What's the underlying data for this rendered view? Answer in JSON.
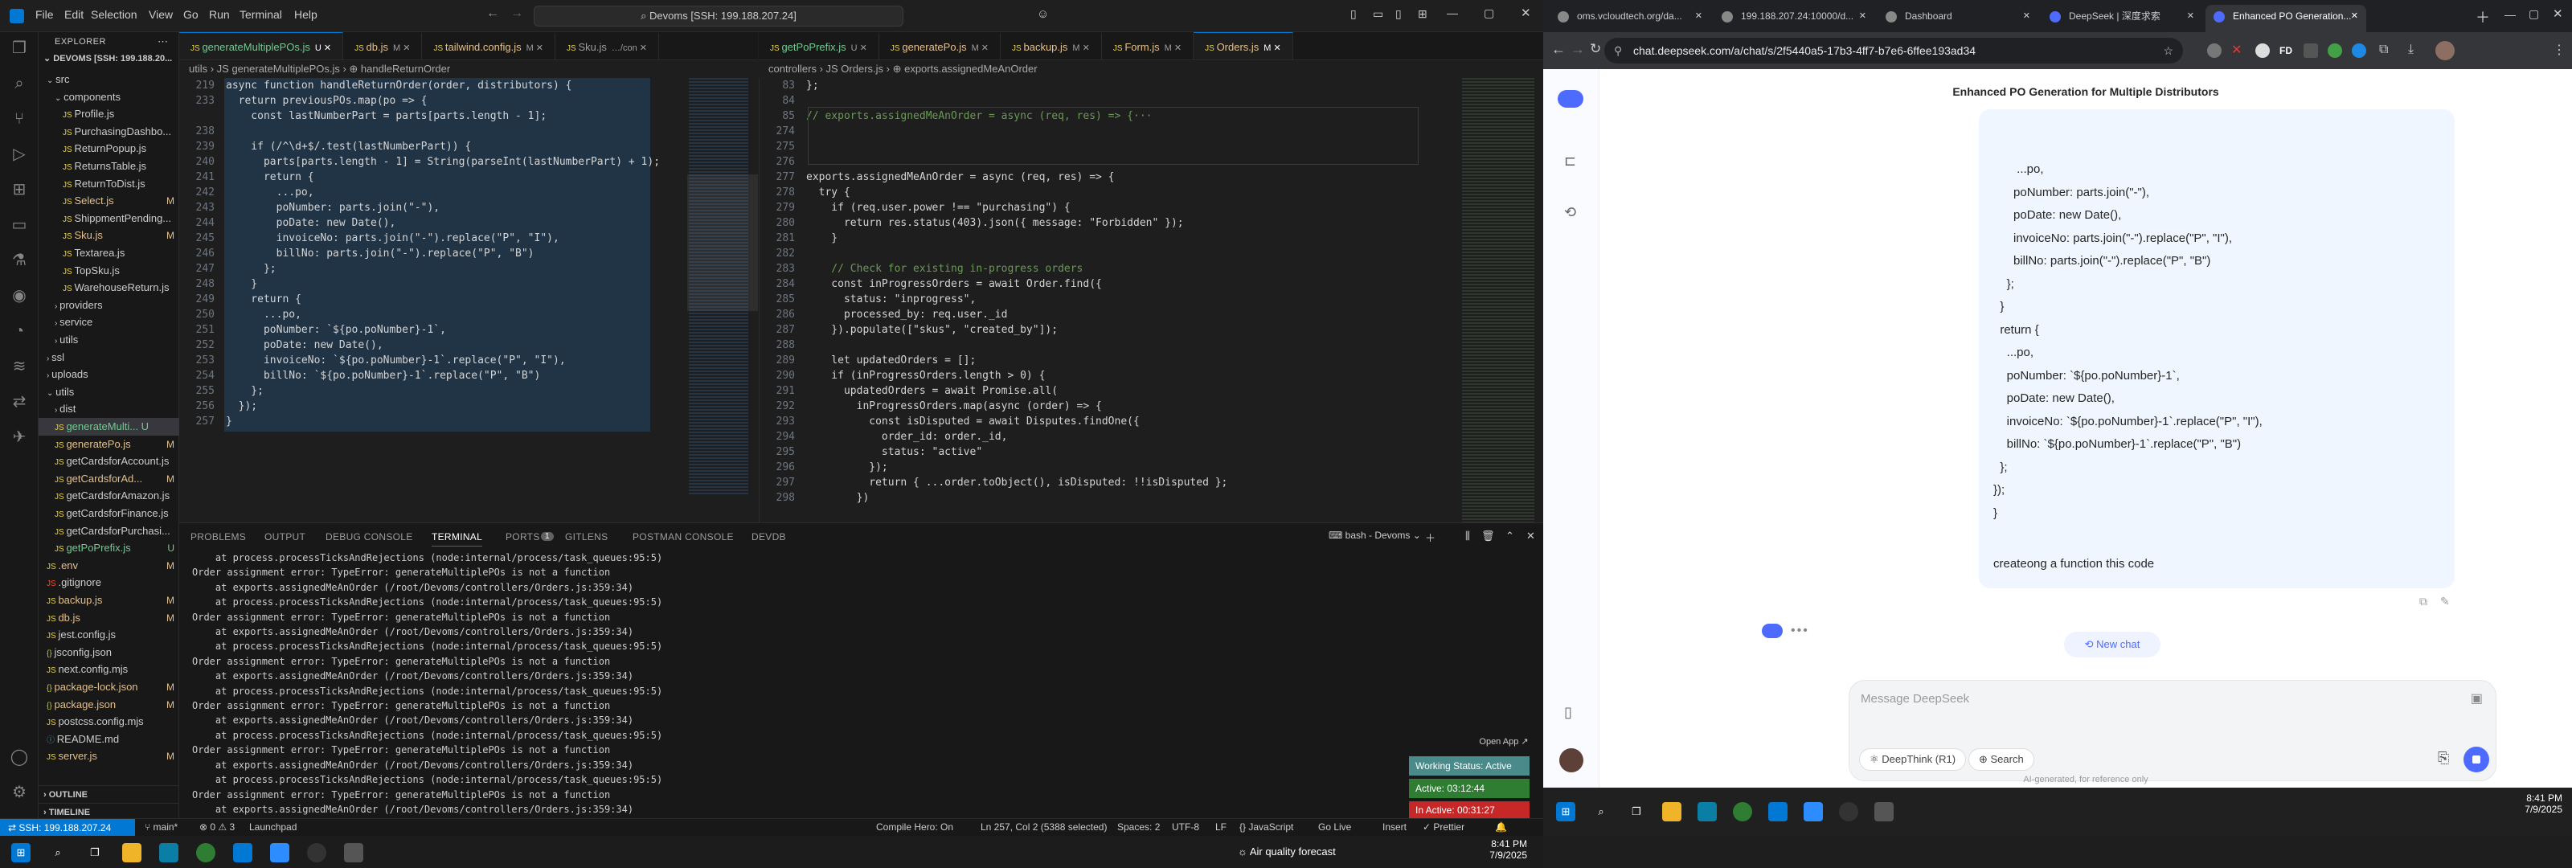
{
  "vscode": {
    "menu": [
      "File",
      "Edit",
      "Selection",
      "View",
      "Go",
      "Run",
      "Terminal",
      "Help"
    ],
    "search_text": "Devoms [SSH: 199.188.207.24]",
    "explorer_title": "EXPLORER",
    "workspace": "DEVOMS [SSH: 199.188.20...",
    "tree": [
      {
        "label": "src",
        "indent": 1,
        "type": "folder-open",
        "badge": ""
      },
      {
        "label": "components",
        "indent": 2,
        "type": "folder-open",
        "badge": ""
      },
      {
        "label": "Profile.js",
        "indent": 3,
        "type": "js",
        "badge": ""
      },
      {
        "label": "PurchasingDashbo...",
        "indent": 3,
        "type": "js",
        "badge": ""
      },
      {
        "label": "ReturnPopup.js",
        "indent": 3,
        "type": "js",
        "badge": ""
      },
      {
        "label": "ReturnsTable.js",
        "indent": 3,
        "type": "js",
        "badge": ""
      },
      {
        "label": "ReturnToDist.js",
        "indent": 3,
        "type": "js",
        "badge": ""
      },
      {
        "label": "Select.js",
        "indent": 3,
        "type": "js",
        "badge": "M"
      },
      {
        "label": "ShippmentPending...",
        "indent": 3,
        "type": "js",
        "badge": ""
      },
      {
        "label": "Sku.js",
        "indent": 3,
        "type": "js",
        "badge": "M"
      },
      {
        "label": "Textarea.js",
        "indent": 3,
        "type": "js",
        "badge": ""
      },
      {
        "label": "TopSku.js",
        "indent": 3,
        "type": "js",
        "badge": ""
      },
      {
        "label": "WarehouseReturn.js",
        "indent": 3,
        "type": "js",
        "badge": ""
      },
      {
        "label": "providers",
        "indent": 2,
        "type": "folder",
        "badge": ""
      },
      {
        "label": "service",
        "indent": 2,
        "type": "folder",
        "badge": ""
      },
      {
        "label": "utils",
        "indent": 2,
        "type": "folder",
        "badge": ""
      },
      {
        "label": "ssl",
        "indent": 1,
        "type": "folder",
        "badge": ""
      },
      {
        "label": "uploads",
        "indent": 1,
        "type": "folder",
        "badge": ""
      },
      {
        "label": "utils",
        "indent": 1,
        "type": "folder-open",
        "badge": ""
      },
      {
        "label": "dist",
        "indent": 2,
        "type": "folder",
        "badge": ""
      },
      {
        "label": "generateMulti... U",
        "indent": 2,
        "type": "js",
        "badge": ""
      },
      {
        "label": "generatePo.js",
        "indent": 2,
        "type": "js",
        "badge": "M"
      },
      {
        "label": "getCardsforAccount.js",
        "indent": 2,
        "type": "js",
        "badge": ""
      },
      {
        "label": "getCardsforAd...",
        "indent": 2,
        "type": "js",
        "badge": "M"
      },
      {
        "label": "getCardsforAmazon.js",
        "indent": 2,
        "type": "js",
        "badge": ""
      },
      {
        "label": "getCardsforFinance.js",
        "indent": 2,
        "type": "js",
        "badge": ""
      },
      {
        "label": "getCardsforPurchasi...",
        "indent": 2,
        "type": "js",
        "badge": ""
      },
      {
        "label": "getPoPrefix.js",
        "indent": 2,
        "type": "js",
        "badge": "U"
      },
      {
        "label": ".env",
        "indent": 1,
        "type": "env",
        "badge": "M"
      },
      {
        "label": ".gitignore",
        "indent": 1,
        "type": "git",
        "badge": ""
      },
      {
        "label": "backup.js",
        "indent": 1,
        "type": "js",
        "badge": "M"
      },
      {
        "label": "db.js",
        "indent": 1,
        "type": "js",
        "badge": "M"
      },
      {
        "label": "jest.config.js",
        "indent": 1,
        "type": "js",
        "badge": ""
      },
      {
        "label": "jsconfig.json",
        "indent": 1,
        "type": "json",
        "badge": ""
      },
      {
        "label": "next.config.mjs",
        "indent": 1,
        "type": "js",
        "badge": ""
      },
      {
        "label": "package-lock.json",
        "indent": 1,
        "type": "json",
        "badge": "M"
      },
      {
        "label": "package.json",
        "indent": 1,
        "type": "json",
        "badge": "M"
      },
      {
        "label": "postcss.config.mjs",
        "indent": 1,
        "type": "js",
        "badge": ""
      },
      {
        "label": "README.md",
        "indent": 1,
        "type": "md",
        "badge": ""
      },
      {
        "label": "server.js",
        "indent": 1,
        "type": "js",
        "badge": "M"
      }
    ],
    "outline_label": "OUTLINE",
    "timeline_label": "TIMELINE",
    "left_tabs": [
      {
        "label": "generateMultiplePOs.js",
        "flag": "U",
        "active": true
      },
      {
        "label": "db.js",
        "flag": "M",
        "active": false
      },
      {
        "label": "tailwind.config.js",
        "flag": "M",
        "active": false
      },
      {
        "label": "Sku.js",
        "flag": "…/con",
        "active": false
      }
    ],
    "right_tabs": [
      {
        "label": "getPoPrefix.js",
        "flag": "U",
        "active": false
      },
      {
        "label": "generatePo.js",
        "flag": "M",
        "active": false
      },
      {
        "label": "backup.js",
        "flag": "M",
        "active": false
      },
      {
        "label": "Form.js",
        "flag": "M",
        "active": false
      },
      {
        "label": "Orders.js",
        "flag": "M",
        "active": true
      }
    ],
    "left_breadcrumb": "utils  ›  JS generateMultiplePOs.js  ›  ⊕ handleReturnOrder",
    "right_breadcrumb": "controllers  ›  JS Orders.js  ›  ⊕ exports.assignedMeAnOrder",
    "left_lines": [
      {
        "n": "219",
        "t": "async function handleReturnOrder(order, distributors) {"
      },
      {
        "n": "233",
        "t": "  return previousPOs.map(po => {"
      },
      {
        "n": "",
        "t": "    const lastNumberPart = parts[parts.length - 1];"
      },
      {
        "n": "238",
        "t": ""
      },
      {
        "n": "239",
        "t": "    if (/^\\d+$/.test(lastNumberPart)) {"
      },
      {
        "n": "240",
        "t": "      parts[parts.length - 1] = String(parseInt(lastNumberPart) + 1);"
      },
      {
        "n": "241",
        "t": "      return {"
      },
      {
        "n": "242",
        "t": "        ...po,"
      },
      {
        "n": "243",
        "t": "        poNumber: parts.join(\"-\"),"
      },
      {
        "n": "244",
        "t": "        poDate: new Date(),"
      },
      {
        "n": "245",
        "t": "        invoiceNo: parts.join(\"-\").replace(\"P\", \"I\"),"
      },
      {
        "n": "246",
        "t": "        billNo: parts.join(\"-\").replace(\"P\", \"B\")"
      },
      {
        "n": "247",
        "t": "      };"
      },
      {
        "n": "248",
        "t": "    }"
      },
      {
        "n": "249",
        "t": "    return {"
      },
      {
        "n": "250",
        "t": "      ...po,"
      },
      {
        "n": "251",
        "t": "      poNumber: `${po.poNumber}-1`,"
      },
      {
        "n": "252",
        "t": "      poDate: new Date(),"
      },
      {
        "n": "253",
        "t": "      invoiceNo: `${po.poNumber}-1`.replace(\"P\", \"I\"),"
      },
      {
        "n": "254",
        "t": "      billNo: `${po.poNumber}-1`.replace(\"P\", \"B\")"
      },
      {
        "n": "255",
        "t": "    };"
      },
      {
        "n": "256",
        "t": "  });"
      },
      {
        "n": "257",
        "t": "}"
      }
    ],
    "right_lines": [
      {
        "n": "83",
        "t": "};"
      },
      {
        "n": "84",
        "t": ""
      },
      {
        "n": "85",
        "t": "// exports.assignedMeAnOrder = async (req, res) => {···"
      },
      {
        "n": "274",
        "t": ""
      },
      {
        "n": "275",
        "t": ""
      },
      {
        "n": "276",
        "t": ""
      },
      {
        "n": "277",
        "t": "exports.assignedMeAnOrder = async (req, res) => {"
      },
      {
        "n": "278",
        "t": "  try {"
      },
      {
        "n": "279",
        "t": "    if (req.user.power !== \"purchasing\") {"
      },
      {
        "n": "280",
        "t": "      return res.status(403).json({ message: \"Forbidden\" });"
      },
      {
        "n": "281",
        "t": "    }"
      },
      {
        "n": "282",
        "t": ""
      },
      {
        "n": "283",
        "t": "    // Check for existing in-progress orders"
      },
      {
        "n": "284",
        "t": "    const inProgressOrders = await Order.find({"
      },
      {
        "n": "285",
        "t": "      status: \"inprogress\","
      },
      {
        "n": "286",
        "t": "      processed_by: req.user._id"
      },
      {
        "n": "287",
        "t": "    }).populate([\"skus\", \"created_by\"]);"
      },
      {
        "n": "288",
        "t": ""
      },
      {
        "n": "289",
        "t": "    let updatedOrders = [];"
      },
      {
        "n": "290",
        "t": "    if (inProgressOrders.length > 0) {"
      },
      {
        "n": "291",
        "t": "      updatedOrders = await Promise.all("
      },
      {
        "n": "292",
        "t": "        inProgressOrders.map(async (order) => {"
      },
      {
        "n": "293",
        "t": "          const isDisputed = await Disputes.findOne({"
      },
      {
        "n": "294",
        "t": "            order_id: order._id,"
      },
      {
        "n": "295",
        "t": "            status: \"active\""
      },
      {
        "n": "296",
        "t": "          });"
      },
      {
        "n": "297",
        "t": "          return { ...order.toObject(), isDisputed: !!isDisputed };"
      },
      {
        "n": "298",
        "t": "        })"
      }
    ],
    "panel_tabs": [
      "PROBLEMS",
      "OUTPUT",
      "DEBUG CONSOLE",
      "TERMINAL",
      "PORTS",
      "GITLENS",
      "POSTMAN CONSOLE",
      "DEVDB"
    ],
    "ports_count": "1",
    "terminal_name": "bash - Devoms",
    "terminal_lines": [
      "    at process.processTicksAndRejections (node:internal/process/task_queues:95:5)",
      "Order assignment error: TypeError: generateMultiplePOs is not a function",
      "    at exports.assignedMeAnOrder (/root/Devoms/controllers/Orders.js:359:34)",
      "    at process.processTicksAndRejections (node:internal/process/task_queues:95:5)",
      "Order assignment error: TypeError: generateMultiplePOs is not a function",
      "    at exports.assignedMeAnOrder (/root/Devoms/controllers/Orders.js:359:34)",
      "    at process.processTicksAndRejections (node:internal/process/task_queues:95:5)",
      "Order assignment error: TypeError: generateMultiplePOs is not a function",
      "    at exports.assignedMeAnOrder (/root/Devoms/controllers/Orders.js:359:34)",
      "    at process.processTicksAndRejections (node:internal/process/task_queues:95:5)",
      "Order assignment error: TypeError: generateMultiplePOs is not a function",
      "    at exports.assignedMeAnOrder (/root/Devoms/controllers/Orders.js:359:34)",
      "    at process.processTicksAndRejections (node:internal/process/task_queues:95:5)",
      "Order assignment error: TypeError: generateMultiplePOs is not a function",
      "    at exports.assignedMeAnOrder (/root/Devoms/controllers/Orders.js:359:34)",
      "    at process.processTicksAndRejections (node:internal/process/task_queues:95:5)",
      "Order assignment error: TypeError: generateMultiplePOs is not a function",
      "    at exports.assignedMeAnOrder (/root/Devoms/controllers/Orders.js:359:34)"
    ],
    "open_app": "Open App ↗",
    "working_status": "Working Status: Active",
    "active_time": "Active: 03:12:44",
    "inactive_time": "In Active: 00:31:27",
    "status": {
      "remote": "⇄ SSH: 199.188.207.24",
      "branch": "main*",
      "errors": "⊗ 0 ⚠ 3",
      "launchpad": "Launchpad",
      "compile": "Compile Hero: On",
      "cursor": "Ln 257, Col 2 (5388 selected)",
      "spaces": "Spaces: 2",
      "encoding": "UTF-8",
      "eol": "LF",
      "lang": "{} JavaScript",
      "golive": "Go Live",
      "insert": "Insert",
      "prettier": "✓ Prettier"
    }
  },
  "browser": {
    "tabs": [
      {
        "label": "oms.vcloudtech.org/da...",
        "active": false
      },
      {
        "label": "199.188.207.24:10000/d...",
        "active": false
      },
      {
        "label": "Dashboard",
        "active": false
      },
      {
        "label": "DeepSeek | 深度求索",
        "active": false
      },
      {
        "label": "Enhanced PO Generation...",
        "active": true
      }
    ],
    "url": "chat.deepseek.com/a/chat/s/2f5440a5-17b3-4ff7-b7e6-6ffee193ad34",
    "chat_title": "Enhanced PO Generation for Multiple Distributors",
    "message_code": "       ...po,\n      poNumber: parts.join(\"-\"),\n      poDate: new Date(),\n      invoiceNo: parts.join(\"-\").replace(\"P\", \"I\"),\n      billNo: parts.join(\"-\").replace(\"P\", \"B\")\n    };\n  }\n  return {\n    ...po,\n    poNumber: `${po.poNumber}-1`,\n    poDate: new Date(),\n    invoiceNo: `${po.poNumber}-1`.replace(\"P\", \"I\"),\n    billNo: `${po.poNumber}-1`.replace(\"P\", \"B\")\n  };\n});\n}",
    "message_text": "createong a function this code",
    "new_chat": "New chat",
    "input_placeholder": "Message DeepSeek",
    "deepthink": "DeepThink (R1)",
    "search": "Search",
    "disclaimer": "AI-generated, for reference only"
  },
  "taskbar": {
    "time_right": "8:41 PM",
    "date_right": "7/9/2025",
    "time_left": "8:41 PM",
    "date_left": "7/9/2025",
    "weather": "Air quality forecast"
  }
}
